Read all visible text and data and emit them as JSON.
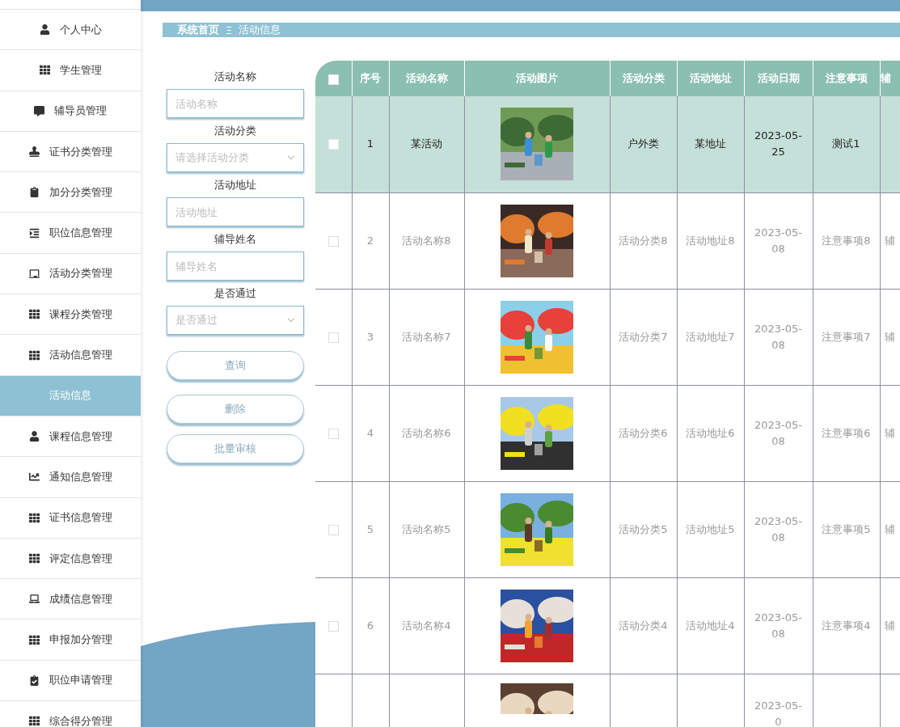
{
  "sidebar": {
    "items": [
      {
        "label": "个人中心",
        "selected": false
      },
      {
        "label": "学生管理",
        "selected": false
      },
      {
        "label": "辅导员管理",
        "selected": false
      },
      {
        "label": "证书分类管理",
        "selected": false
      },
      {
        "label": "加分分类管理",
        "selected": false
      },
      {
        "label": "职位信息管理",
        "selected": false
      },
      {
        "label": "活动分类管理",
        "selected": false
      },
      {
        "label": "课程分类管理",
        "selected": false
      },
      {
        "label": "活动信息管理",
        "selected": false,
        "children": [
          {
            "label": "活动信息",
            "selected": true
          }
        ]
      },
      {
        "label": "课程信息管理",
        "selected": false
      },
      {
        "label": "通知信息管理",
        "selected": false
      },
      {
        "label": "证书信息管理",
        "selected": false
      },
      {
        "label": "评定信息管理",
        "selected": false
      },
      {
        "label": "成绩信息管理",
        "selected": false
      },
      {
        "label": "申报加分管理",
        "selected": false
      },
      {
        "label": "职位申请管理",
        "selected": false
      },
      {
        "label": "综合得分管理",
        "selected": false
      }
    ]
  },
  "breadcrumb": {
    "home": "系统首页",
    "separator": "Ξ",
    "current": "活动信息"
  },
  "search_form": {
    "fields": [
      {
        "kind": "input",
        "label": "活动名称",
        "placeholder": "活动名称"
      },
      {
        "kind": "select",
        "label": "活动分类",
        "placeholder": "请选择活动分类"
      },
      {
        "kind": "input",
        "label": "活动地址",
        "placeholder": "活动地址"
      },
      {
        "kind": "input",
        "label": "辅导姓名",
        "placeholder": "辅导姓名"
      },
      {
        "kind": "select",
        "label": "是否通过",
        "placeholder": "是否通过"
      }
    ],
    "buttons": [
      "查询",
      "删除",
      "批量审核"
    ]
  },
  "table": {
    "select_all": {
      "checked": false
    },
    "columns": [
      "序号",
      "活动名称",
      "活动图片",
      "活动分类",
      "活动地址",
      "活动日期",
      "注意事项",
      "辅"
    ],
    "rows": [
      {
        "selected": true,
        "checked": false,
        "cells": [
          "1",
          "某活动",
          {
            "kind": "picture"
          },
          "户外类",
          "某地址",
          "2023-05-25",
          "测试1",
          ""
        ]
      },
      {
        "selected": false,
        "checked": false,
        "cells": [
          "2",
          "活动名称8",
          {
            "kind": "picture"
          },
          "活动分类8",
          "活动地址8",
          "2023-05-08",
          "注意事项8",
          "辅"
        ]
      },
      {
        "selected": false,
        "checked": false,
        "cells": [
          "3",
          "活动名称7",
          {
            "kind": "picture"
          },
          "活动分类7",
          "活动地址7",
          "2023-05-08",
          "注意事项7",
          "辅"
        ]
      },
      {
        "selected": false,
        "checked": false,
        "cells": [
          "4",
          "活动名称6",
          {
            "kind": "picture"
          },
          "活动分类6",
          "活动地址6",
          "2023-05-08",
          "注意事项6",
          "辅"
        ]
      },
      {
        "selected": false,
        "checked": false,
        "cells": [
          "5",
          "活动名称5",
          {
            "kind": "picture"
          },
          "活动分类5",
          "活动地址5",
          "2023-05-08",
          "注意事项5",
          "辅"
        ]
      },
      {
        "selected": false,
        "checked": false,
        "cells": [
          "6",
          "活动名称4",
          {
            "kind": "picture"
          },
          "活动分类4",
          "活动地址4",
          "2023-05-08",
          "注意事项4",
          "辅"
        ]
      },
      {
        "selected": false,
        "cells": [
          "",
          "",
          {
            "kind": "picture"
          },
          "",
          "",
          "2023-05-0",
          "",
          ""
        ]
      }
    ]
  }
}
